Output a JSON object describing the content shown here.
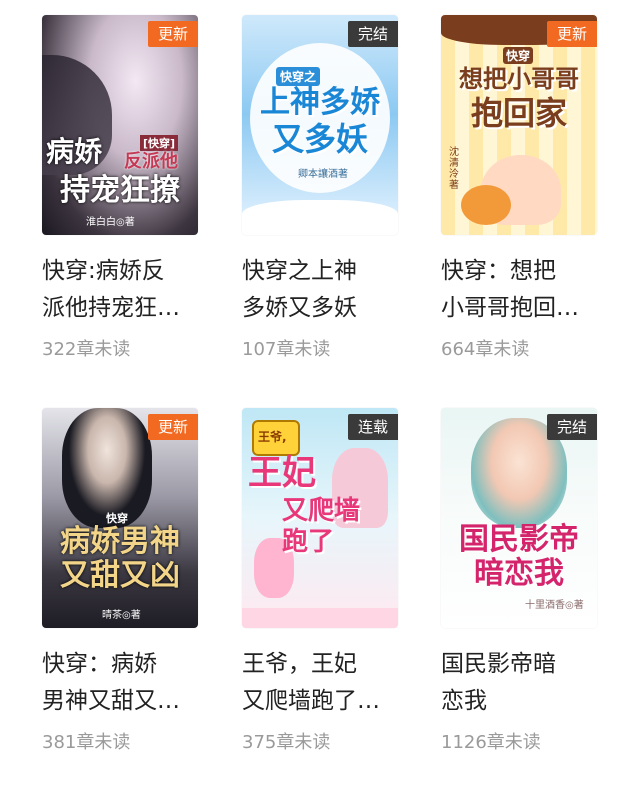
{
  "books": [
    {
      "badge": "更新",
      "badge_kind": "update",
      "cover_tag": "[快穿]",
      "cover_line1": "病娇",
      "cover_line1b": "反派他",
      "cover_line2": "持宠狂撩",
      "cover_author": "淮白白◎著",
      "title_line1": "快穿:病娇反",
      "title_line2": "派他持宠狂…",
      "progress": "322章未读"
    },
    {
      "badge": "完结",
      "badge_kind": "done",
      "cover_tag": "快穿之",
      "cover_line1": "上神多娇",
      "cover_line2": "又多妖",
      "cover_author": "卿本讓酒著",
      "title_line1": "快穿之上神",
      "title_line2": "多娇又多妖",
      "progress": "107章未读"
    },
    {
      "badge": "更新",
      "badge_kind": "update",
      "cover_tag": "快穿",
      "cover_line1": "想把小哥哥",
      "cover_line2": "抱回家",
      "cover_author": "沈清泠著",
      "title_line1": "快穿：想把",
      "title_line2": "小哥哥抱回…",
      "progress": "664章未读"
    },
    {
      "badge": "更新",
      "badge_kind": "update",
      "cover_tag": "快穿",
      "cover_line1": "病娇男神",
      "cover_line2": "又甜又凶",
      "cover_author": "晴茶◎著",
      "title_line1": "快穿：病娇",
      "title_line2": "男神又甜又…",
      "progress": "381章未读"
    },
    {
      "badge": "连载",
      "badge_kind": "serial",
      "cover_tag": "王爷,",
      "cover_line1": "王妃",
      "cover_line2": "又爬墙跑了",
      "cover_author": "",
      "title_line1": "王爷，王妃",
      "title_line2": "又爬墙跑了…",
      "progress": "375章未读"
    },
    {
      "badge": "完结",
      "badge_kind": "done",
      "cover_tag": "",
      "cover_line1": "国民影帝",
      "cover_line2": "暗恋我",
      "cover_author": "十里酒香◎著",
      "title_line1": "国民影帝暗",
      "title_line2": "恋我",
      "progress": "1126章未读"
    }
  ],
  "colors": {
    "badge_update": "#f26a21",
    "badge_dark": "#3a3a3a",
    "title_text": "#222222",
    "progress_text": "#9a9a9a"
  }
}
